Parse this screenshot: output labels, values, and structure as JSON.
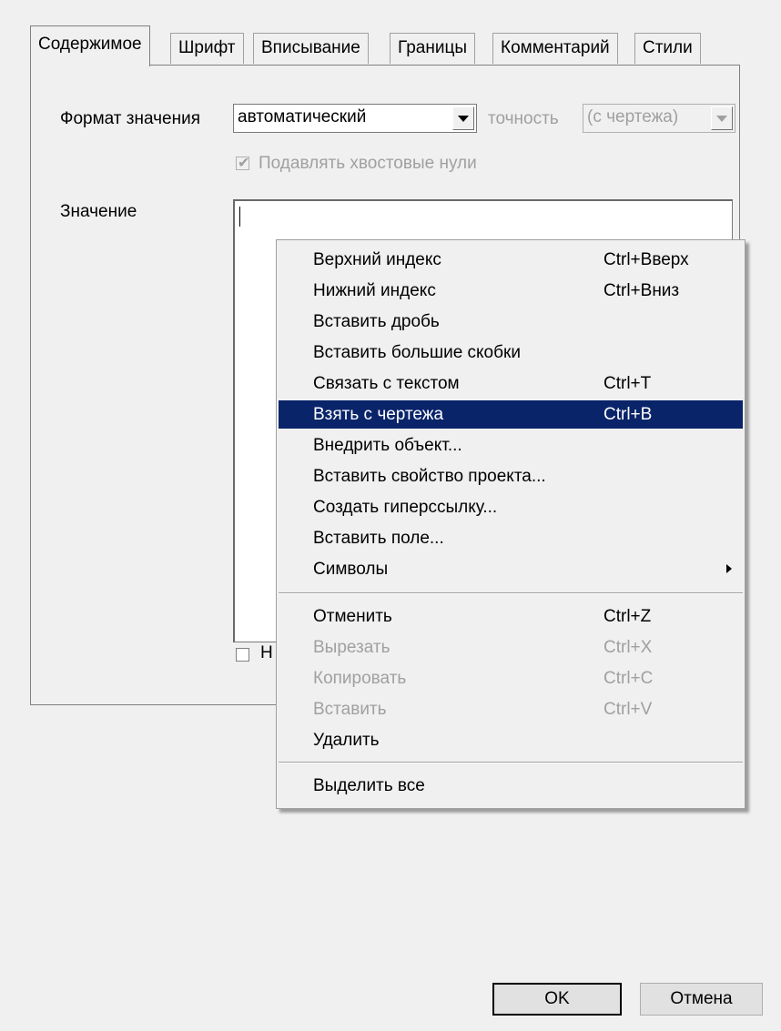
{
  "tabs": [
    "Содержимое",
    "Шрифт",
    "Вписывание",
    "Границы",
    "Комментарий",
    "Стили"
  ],
  "format": {
    "label": "Формат значения",
    "value": "автоматический",
    "precision_label": "точность",
    "precision_value": "(с чертежа)"
  },
  "suppress_zeros": {
    "label": "Подавлять хвостовые нули",
    "checked": true
  },
  "value_label": "Значение",
  "hidden_checkbox_label": "Н",
  "menu": {
    "items": [
      {
        "label": "Верхний индекс",
        "shortcut": "Ctrl+Вверх"
      },
      {
        "label": "Нижний индекс",
        "shortcut": "Ctrl+Вниз"
      },
      {
        "label": "Вставить дробь",
        "shortcut": ""
      },
      {
        "label": "Вставить большие скобки",
        "shortcut": ""
      },
      {
        "label": "Связать с текстом",
        "shortcut": "Ctrl+T"
      },
      {
        "label": "Взять с чертежа",
        "shortcut": "Ctrl+B",
        "highlighted": true
      },
      {
        "label": "Внедрить объект...",
        "shortcut": ""
      },
      {
        "label": "Вставить свойство проекта...",
        "shortcut": ""
      },
      {
        "label": "Создать гиперссылку...",
        "shortcut": ""
      },
      {
        "label": "Вставить поле...",
        "shortcut": ""
      },
      {
        "label": "Символы",
        "shortcut": "",
        "submenu": true
      },
      {
        "label": "Отменить",
        "shortcut": "Ctrl+Z"
      },
      {
        "label": "Вырезать",
        "shortcut": "Ctrl+X",
        "disabled": true
      },
      {
        "label": "Копировать",
        "shortcut": "Ctrl+C",
        "disabled": true
      },
      {
        "label": "Вставить",
        "shortcut": "Ctrl+V",
        "disabled": true
      },
      {
        "label": "Удалить",
        "shortcut": ""
      },
      {
        "label": "Выделить все",
        "shortcut": ""
      }
    ]
  },
  "buttons": {
    "ok": "OK",
    "cancel": "Отмена"
  },
  "colors": {
    "highlight": "#0a246a",
    "background": "#f0f0f0",
    "disabled_text": "#a0a0a0"
  },
  "icons": {
    "dropdown": "chevron-down-icon",
    "submenu": "chevron-right-icon",
    "check": "check-icon"
  }
}
